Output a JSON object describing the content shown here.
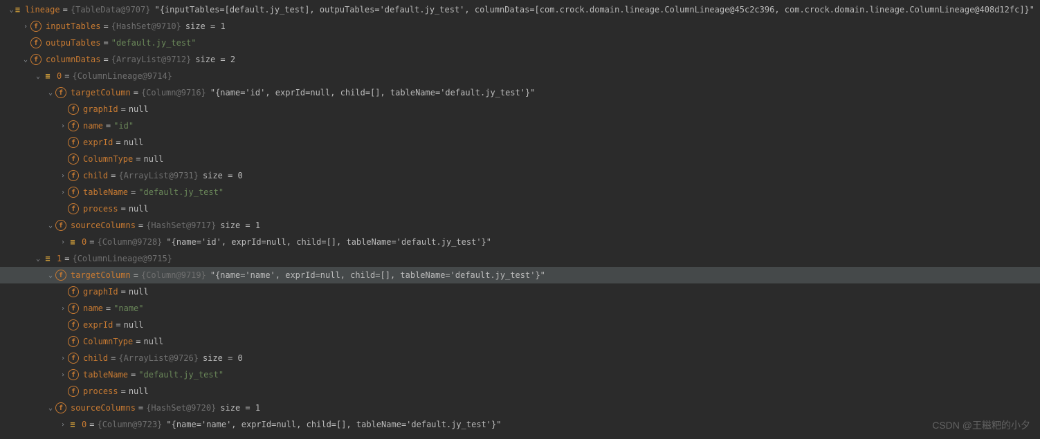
{
  "watermark": "CSDN @王糍粑的小夕",
  "rows": [
    {
      "indent": 0,
      "arrow": "down",
      "icon": "obj",
      "name": "lineage",
      "eq": 1,
      "obj": "{TableData@9707}",
      "summary": "\"{inputTables=[default.jy_test], outpuTables='default.jy_test', columnDatas=[com.crock.domain.lineage.ColumnLineage@45c2c396, com.crock.domain.lineage.ColumnLineage@408d12fc]}\""
    },
    {
      "indent": 1,
      "arrow": "right",
      "icon": "f",
      "name": "inputTables",
      "eq": 1,
      "obj": "{HashSet@9710}",
      "annot": "size = 1"
    },
    {
      "indent": 1,
      "arrow": "none",
      "icon": "f",
      "name": "outpuTables",
      "eq": 1,
      "string": "\"default.jy_test\""
    },
    {
      "indent": 1,
      "arrow": "down",
      "icon": "f",
      "name": "columnDatas",
      "eq": 1,
      "obj": "{ArrayList@9712}",
      "annot": "size = 2"
    },
    {
      "indent": 2,
      "arrow": "down",
      "icon": "obj",
      "name": "0",
      "eq": 1,
      "obj": "{ColumnLineage@9714}"
    },
    {
      "indent": 3,
      "arrow": "down",
      "icon": "f",
      "name": "targetColumn",
      "eq": 1,
      "obj": "{Column@9716}",
      "summary": "\"{name='id', exprId=null, child=[], tableName='default.jy_test'}\""
    },
    {
      "indent": 4,
      "arrow": "none",
      "icon": "f",
      "name": "graphId",
      "eq": 1,
      "value": "null"
    },
    {
      "indent": 4,
      "arrow": "right",
      "icon": "f",
      "name": "name",
      "eq": 1,
      "string": "\"id\""
    },
    {
      "indent": 4,
      "arrow": "none",
      "icon": "f",
      "name": "exprId",
      "eq": 1,
      "value": "null"
    },
    {
      "indent": 4,
      "arrow": "none",
      "icon": "f",
      "name": "ColumnType",
      "eq": 1,
      "value": "null"
    },
    {
      "indent": 4,
      "arrow": "right",
      "icon": "f",
      "name": "child",
      "eq": 1,
      "obj": "{ArrayList@9731}",
      "annot": "size = 0"
    },
    {
      "indent": 4,
      "arrow": "right",
      "icon": "f",
      "name": "tableName",
      "eq": 1,
      "string": "\"default.jy_test\""
    },
    {
      "indent": 4,
      "arrow": "none",
      "icon": "f",
      "name": "process",
      "eq": 1,
      "value": "null"
    },
    {
      "indent": 3,
      "arrow": "down",
      "icon": "f",
      "name": "sourceColumns",
      "eq": 1,
      "obj": "{HashSet@9717}",
      "annot": "size = 1"
    },
    {
      "indent": 4,
      "arrow": "right",
      "icon": "obj",
      "name": "0",
      "eq": 1,
      "obj": "{Column@9728}",
      "summary": "\"{name='id', exprId=null, child=[], tableName='default.jy_test'}\""
    },
    {
      "indent": 2,
      "arrow": "down",
      "icon": "obj",
      "name": "1",
      "eq": 1,
      "obj": "{ColumnLineage@9715}"
    },
    {
      "indent": 3,
      "arrow": "down",
      "icon": "f",
      "name": "targetColumn",
      "eq": 1,
      "obj": "{Column@9719}",
      "summary": "\"{name='name', exprId=null, child=[], tableName='default.jy_test'}\"",
      "sel": true
    },
    {
      "indent": 4,
      "arrow": "none",
      "icon": "f",
      "name": "graphId",
      "eq": 1,
      "value": "null"
    },
    {
      "indent": 4,
      "arrow": "right",
      "icon": "f",
      "name": "name",
      "eq": 1,
      "string": "\"name\""
    },
    {
      "indent": 4,
      "arrow": "none",
      "icon": "f",
      "name": "exprId",
      "eq": 1,
      "value": "null"
    },
    {
      "indent": 4,
      "arrow": "none",
      "icon": "f",
      "name": "ColumnType",
      "eq": 1,
      "value": "null"
    },
    {
      "indent": 4,
      "arrow": "right",
      "icon": "f",
      "name": "child",
      "eq": 1,
      "obj": "{ArrayList@9726}",
      "annot": "size = 0"
    },
    {
      "indent": 4,
      "arrow": "right",
      "icon": "f",
      "name": "tableName",
      "eq": 1,
      "string": "\"default.jy_test\""
    },
    {
      "indent": 4,
      "arrow": "none",
      "icon": "f",
      "name": "process",
      "eq": 1,
      "value": "null"
    },
    {
      "indent": 3,
      "arrow": "down",
      "icon": "f",
      "name": "sourceColumns",
      "eq": 1,
      "obj": "{HashSet@9720}",
      "annot": "size = 1"
    },
    {
      "indent": 4,
      "arrow": "right",
      "icon": "obj",
      "name": "0",
      "eq": 1,
      "obj": "{Column@9723}",
      "summary": "\"{name='name', exprId=null, child=[], tableName='default.jy_test'}\""
    }
  ]
}
